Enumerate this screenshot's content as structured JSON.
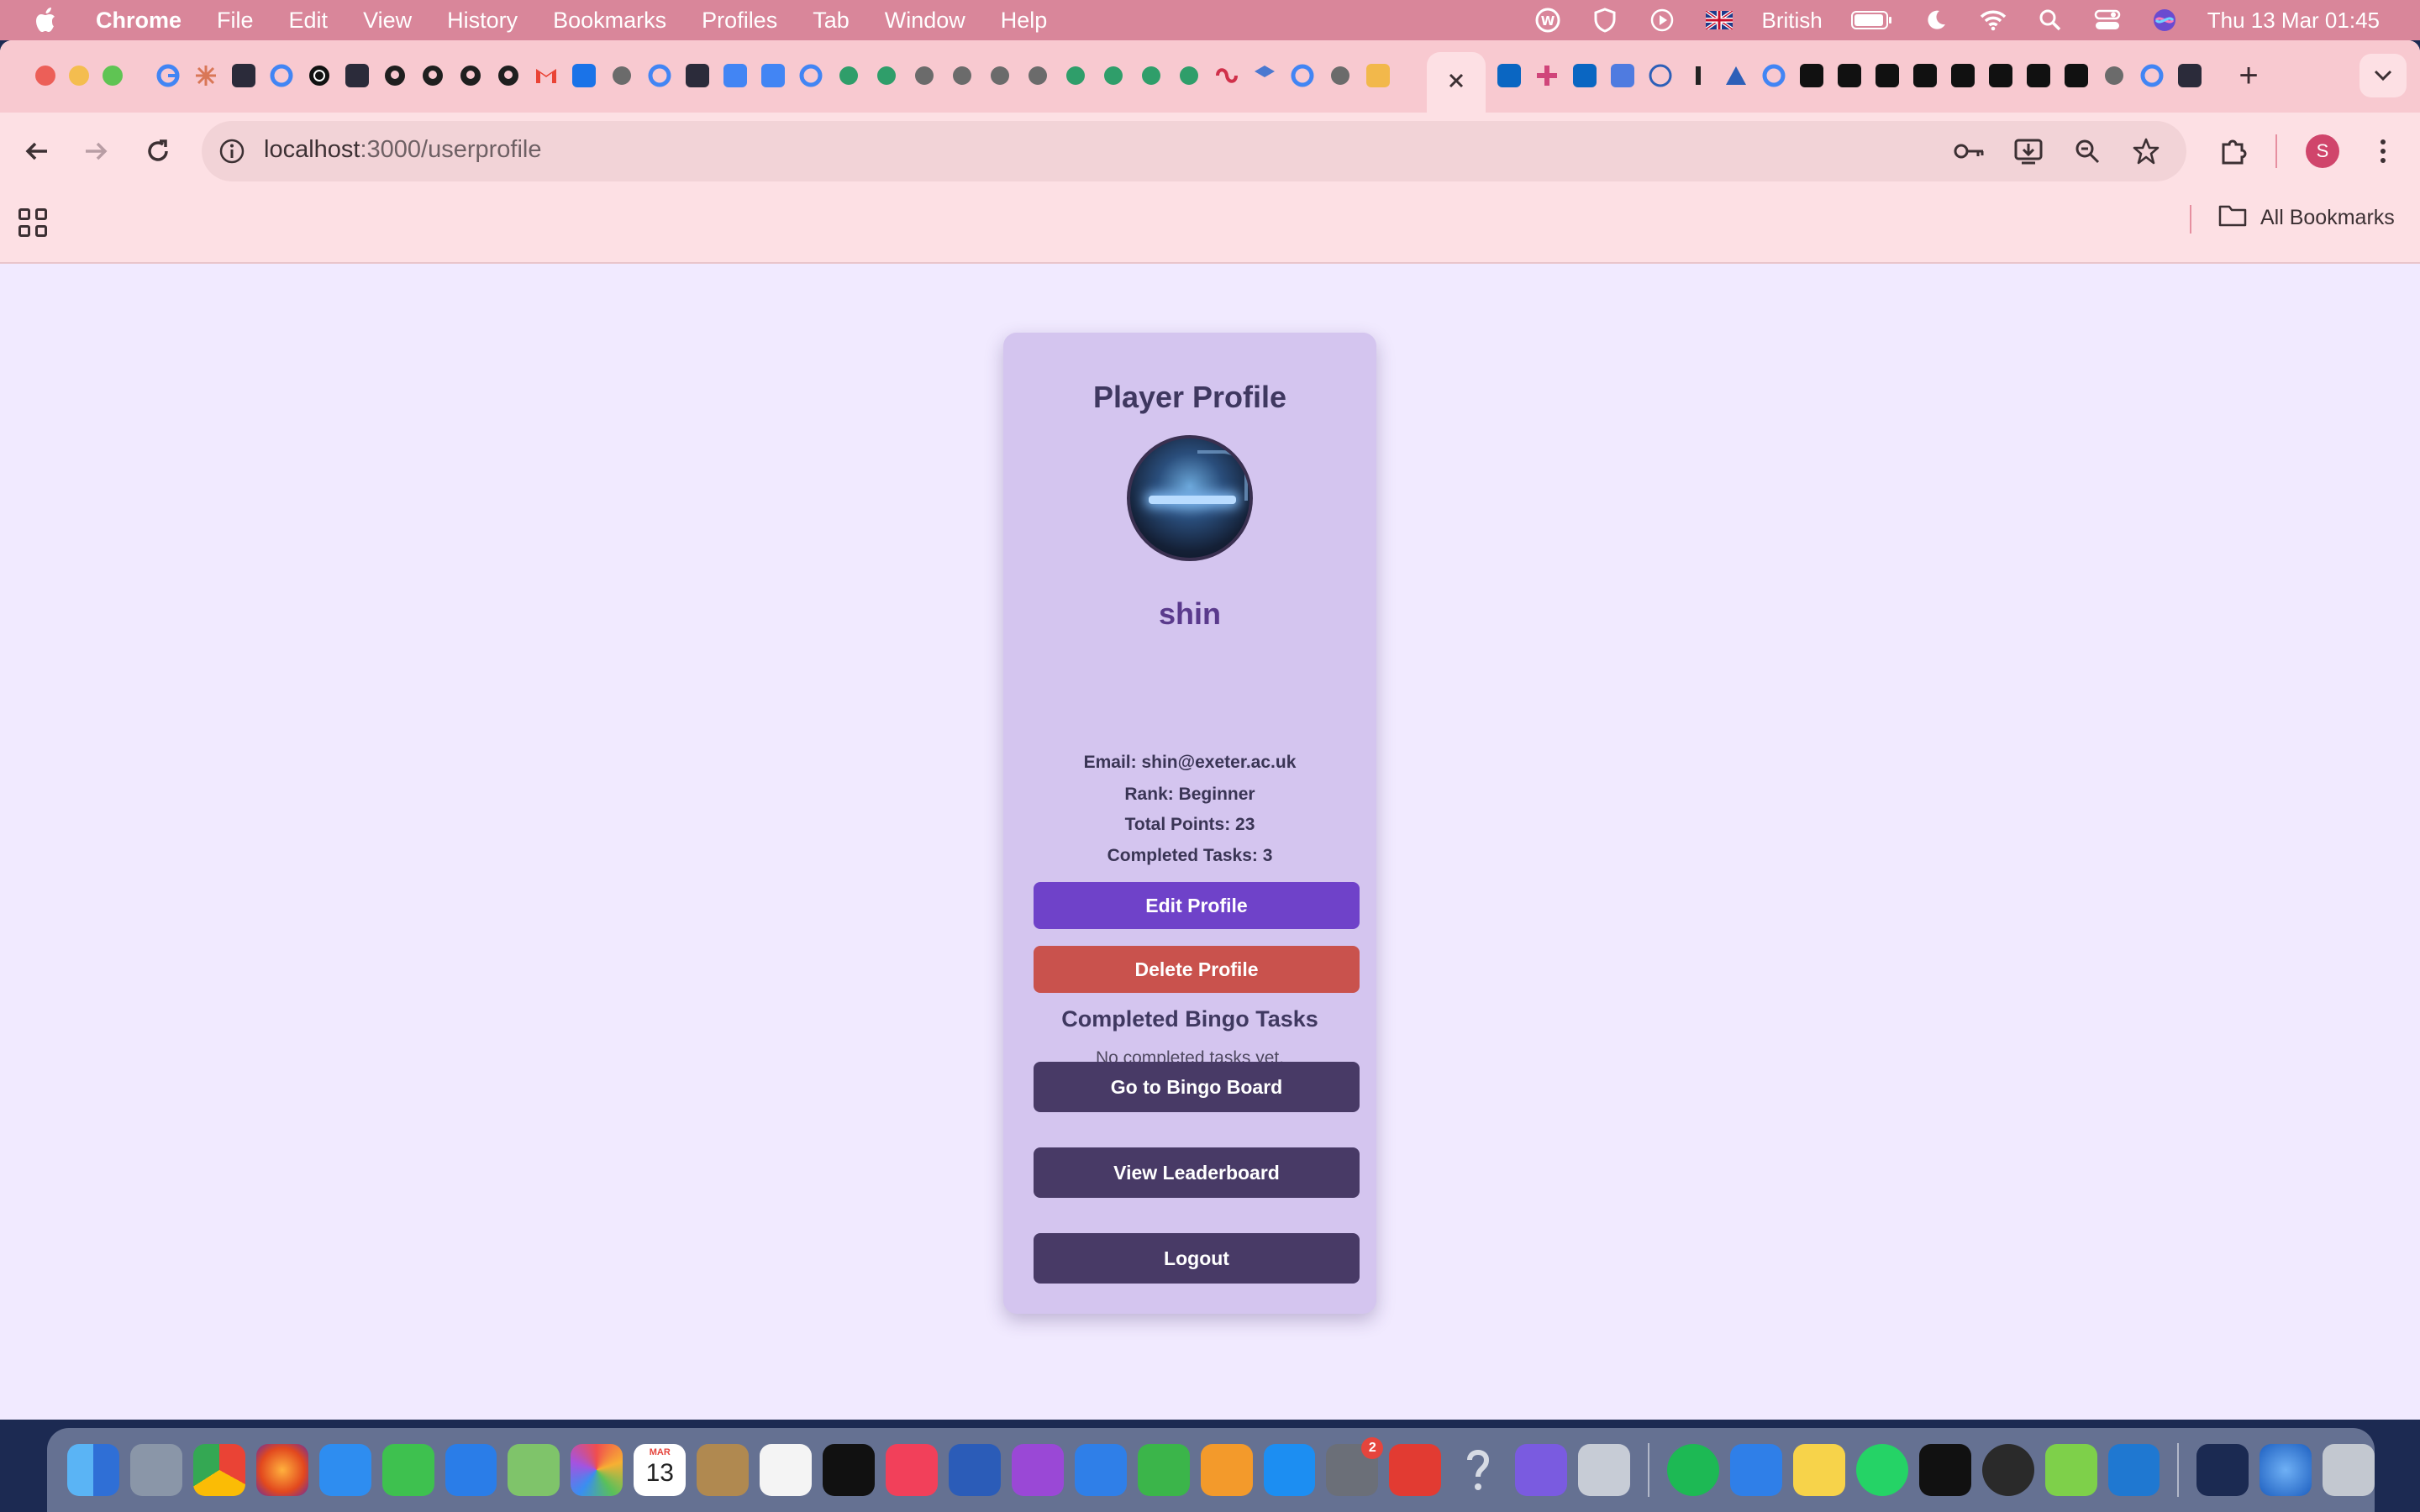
{
  "menubar": {
    "app_name": "Chrome",
    "items": [
      "File",
      "Edit",
      "View",
      "History",
      "Bookmarks",
      "Profiles",
      "Tab",
      "Window",
      "Help"
    ],
    "language": "British",
    "datetime": "Thu 13 Mar  01:45"
  },
  "browser": {
    "url_host": "localhost",
    "url_path": ":3000/userprofile",
    "profile_initial": "S",
    "all_bookmarks": "All Bookmarks",
    "accent": "#f8c9d0"
  },
  "profile": {
    "title": "Player Profile",
    "username": "shin",
    "email_line": "Email: shin@exeter.ac.uk",
    "rank_line": "Rank: Beginner",
    "points_line": "Total Points: 23",
    "completed_line": "Completed Tasks: 3",
    "edit_label": "Edit Profile",
    "delete_label": "Delete Profile",
    "tasks_heading": "Completed Bingo Tasks",
    "no_tasks": "No completed tasks yet.",
    "bingo_label": "Go to Bingo Board",
    "leaderboard_label": "View Leaderboard",
    "logout_label": "Logout",
    "colors": {
      "primary": "#6f42c9",
      "danger": "#c9524d",
      "dark": "#483a66",
      "card": "#d4c5ef"
    }
  },
  "dock": {
    "calendar_month": "MAR",
    "calendar_day": "13",
    "settings_badge": "2"
  }
}
